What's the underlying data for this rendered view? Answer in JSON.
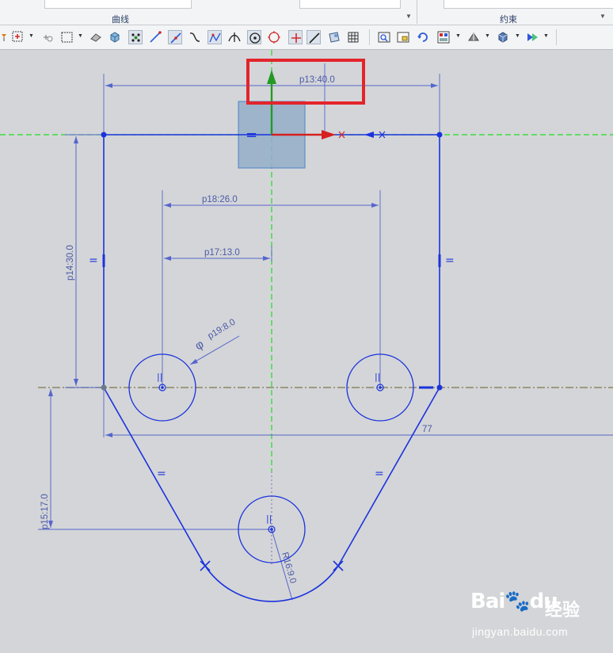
{
  "ribbon": {
    "group_curve": "曲线",
    "group_constraint": "约束"
  },
  "toolbar_icons": [
    "sketch-filter-icon",
    "select-point-icon",
    "snap-icon",
    "box-select-icon",
    "view-shaded-icon",
    "view-cube-icon",
    "point-constraint-icon",
    "line-icon",
    "line-point-icon",
    "spline-icon",
    "curve-icon",
    "intersection-icon",
    "point-on-curve-icon",
    "circle-icon",
    "cross-icon",
    "tangent-line-icon",
    "render-icon",
    "grid-icon",
    "fit-view-icon",
    "zoom-window-icon",
    "rotate-view-icon",
    "layout-icon",
    "render-style-icon",
    "shaded-cube-icon",
    "view-orient-icon"
  ],
  "colors": {
    "sketch_line": "#1a33dd",
    "dimension": "#5566cc",
    "reference_green": "#22dd22",
    "centerline": "#8a8665",
    "highlight_box": "#e3242b",
    "selection_fill": "#93aec9"
  },
  "dimensions": {
    "top_width": "p13:40.0",
    "hole_spacing": "p18:26.0",
    "half_spacing": "p17:13.0",
    "hole_diameter": "p19:8.0",
    "diameter_symbol": "φ",
    "left_height": "p14:30.0",
    "bottom_offset": "p15:17.0",
    "arc_radius": "R16:9.0",
    "reference_width": "77"
  },
  "constraint_marks": {
    "equal": "=",
    "parallel": "||"
  },
  "watermark": {
    "logo": "Bai",
    "logo2": "du",
    "text": "经验",
    "url": "jingyan.baidu.com"
  }
}
